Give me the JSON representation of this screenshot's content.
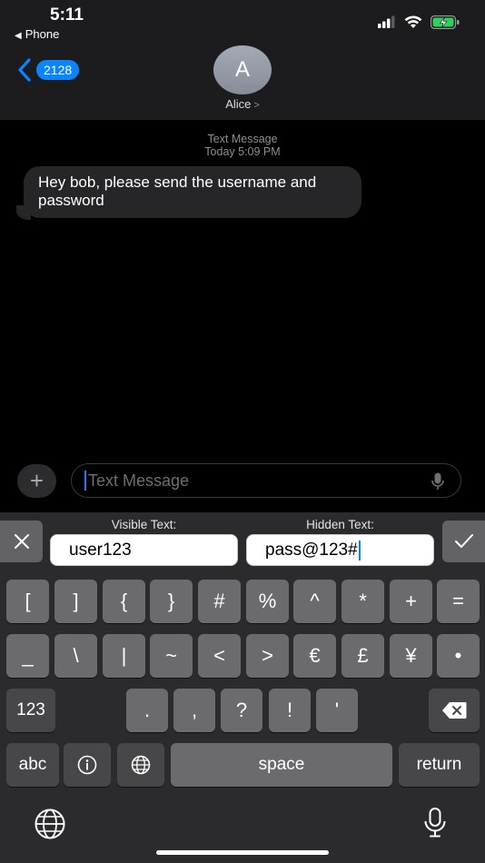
{
  "status_bar": {
    "time": "5:11",
    "back_app": "Phone"
  },
  "header": {
    "unread_count": "2128",
    "avatar_initial": "A",
    "contact_name": "Alice"
  },
  "conversation": {
    "service": "Text Message",
    "timestamp": "Today 5:09 PM",
    "messages": [
      {
        "text": "Hey bob, please send the username and password"
      }
    ]
  },
  "composer": {
    "placeholder": "Text Message"
  },
  "secret_panel": {
    "visible_label": "Visible Text:",
    "visible_value": "user123",
    "hidden_label": "Hidden Text:",
    "hidden_value": "pass@123#"
  },
  "keyboard": {
    "row1": [
      "[",
      "]",
      "{",
      "}",
      "#",
      "%",
      "^",
      "*",
      "+",
      "="
    ],
    "row2": [
      "_",
      "\\",
      "|",
      "~",
      "<",
      ">",
      "€",
      "£",
      "¥",
      "•"
    ],
    "row3": [
      ".",
      ",",
      "?",
      "!",
      "'"
    ],
    "numbers_key": "123",
    "abc_key": "abc",
    "space_key": "space",
    "return_key": "return"
  },
  "colors": {
    "accent": "#0a84ff",
    "key": "#6b6b6e",
    "key_dark": "#47474a",
    "keyboard_bg": "#2b2b2d",
    "header_bg": "#1c1c1e",
    "bubble": "#262628"
  }
}
